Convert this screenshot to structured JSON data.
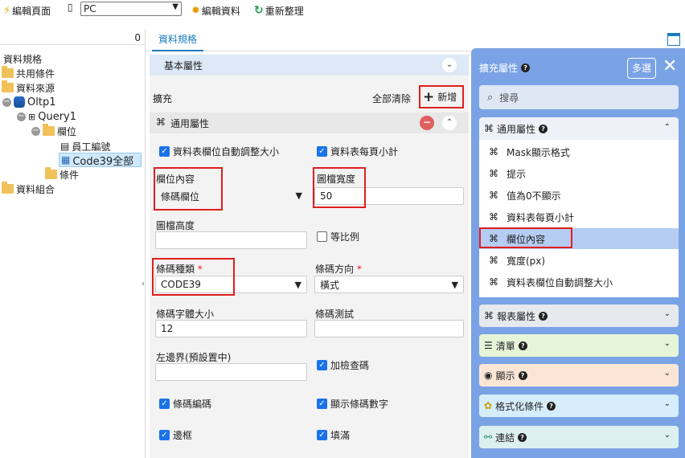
{
  "toolbar": {
    "design_page": "編輯頁面",
    "device_value": "PC",
    "design_data": "編輯資料",
    "refresh": "重新整理"
  },
  "tree": {
    "count": "0",
    "root": "資料規格",
    "shared": "共用條件",
    "datasource": "資料來源",
    "db": "Oltp1",
    "query": "Query1",
    "fields": "欄位",
    "field1": "員工編號",
    "field2": "Code39全部",
    "conditions": "條件",
    "combo": "資料組合"
  },
  "tab": {
    "label": "資料規格"
  },
  "form": {
    "basic_section": "基本屬性",
    "expand_label": "擴充",
    "clear_all": "全部清除",
    "add_label": "新增",
    "common_section": "通用屬性",
    "auto_resize_label": "資料表欄位自動調整大小",
    "per_page_subtotal_label": "資料表每頁小計",
    "field_content_label": "欄位內容",
    "field_content_value": "條碼欄位",
    "image_width_label": "圖檔寬度",
    "image_width_value": "50",
    "image_height_label": "圖檔高度",
    "image_height_value": "",
    "ratio_label": "等比例",
    "barcode_type_label": "條碼種類",
    "barcode_type_value": "CODE39",
    "barcode_dir_label": "條碼方向",
    "barcode_dir_value": "橫式",
    "font_size_label": "條碼字體大小",
    "font_size_value": "12",
    "barcode_test_label": "條碼測試",
    "barcode_test_value": "",
    "left_margin_label": "左邊界(預設置中)",
    "left_margin_value": "",
    "checksum_label": "加檢查碼",
    "encode_label": "條碼編碼",
    "show_digits_label": "顯示條碼數字",
    "border_label": "邊框",
    "fill_label": "填滿",
    "required_mark": "*"
  },
  "rpanel": {
    "title": "擴充屬性",
    "multi_select": "多選",
    "search_placeholder": "搜尋",
    "common_section": "通用屬性",
    "items": [
      "Mask顯示格式",
      "提示",
      "值為0不顯示",
      "資料表每頁小計",
      "欄位內容",
      "寬度(px)",
      "資料表欄位自動調整大小"
    ],
    "report_section": "報表屬性",
    "list_section": "清單",
    "display_section": "顯示",
    "format_section": "格式化條件",
    "link_section": "連結"
  },
  "colors": {
    "accent": "#1a73e8",
    "panel": "#7aa3e6",
    "highlight": "#e01e1e"
  }
}
